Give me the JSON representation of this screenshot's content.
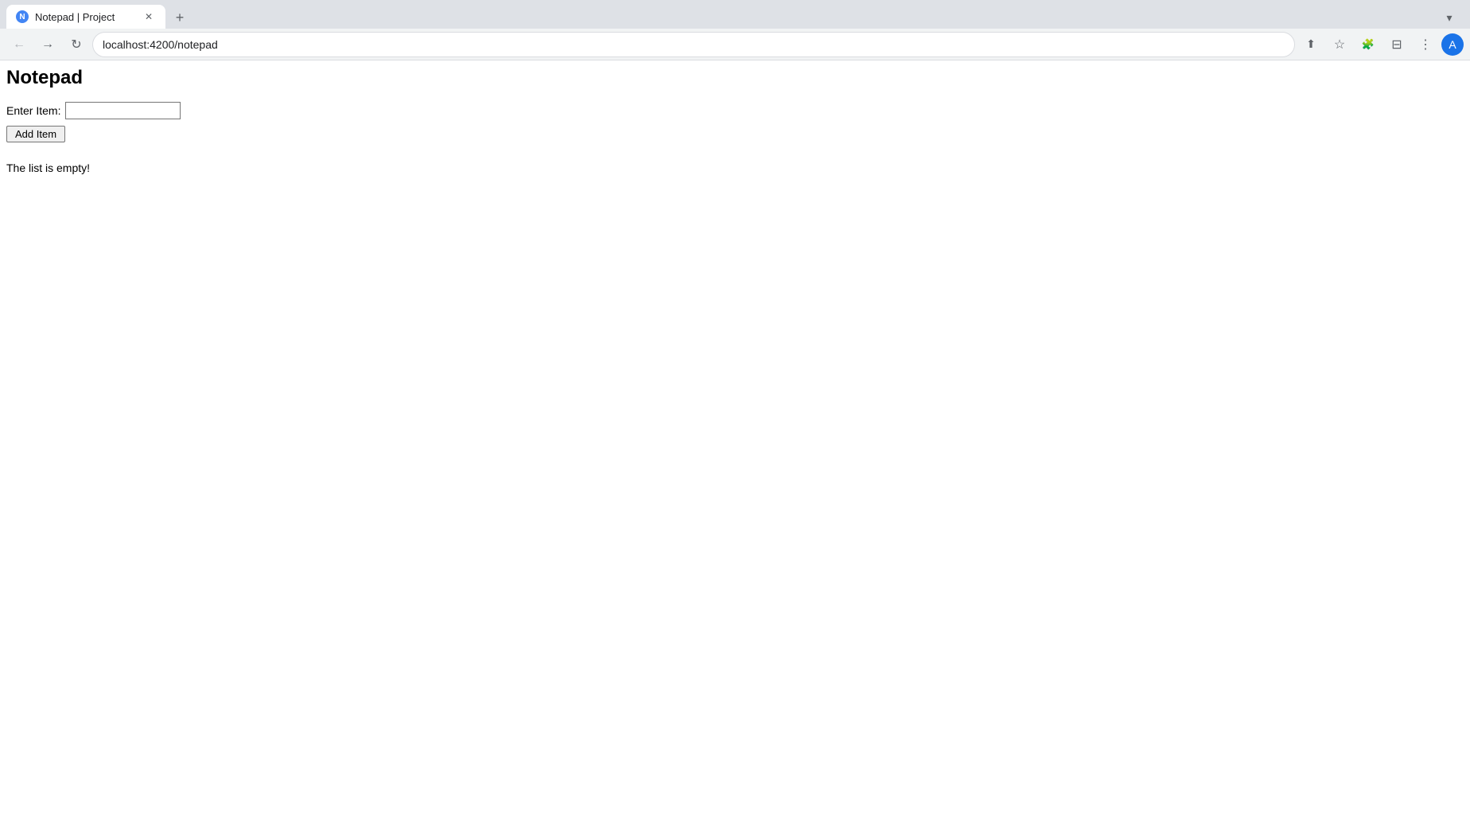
{
  "browser": {
    "tab": {
      "favicon_letter": "N",
      "title": "Notepad | Project",
      "close_symbol": "✕"
    },
    "tab_new_symbol": "+",
    "tab_list_symbol": "▾",
    "nav": {
      "back_symbol": "←",
      "forward_symbol": "→",
      "reload_symbol": "↻",
      "url": "localhost:4200/notepad",
      "bookmark_symbol": "☆",
      "extensions_symbol": "🧩",
      "sidebar_symbol": "⊟",
      "menu_symbol": "⋮",
      "profile_letter": "A"
    }
  },
  "page": {
    "title": "Notepad",
    "form": {
      "label": "Enter Item:",
      "input_value": "",
      "input_placeholder": "",
      "button_label": "Add Item"
    },
    "empty_message": "The list is empty!"
  }
}
